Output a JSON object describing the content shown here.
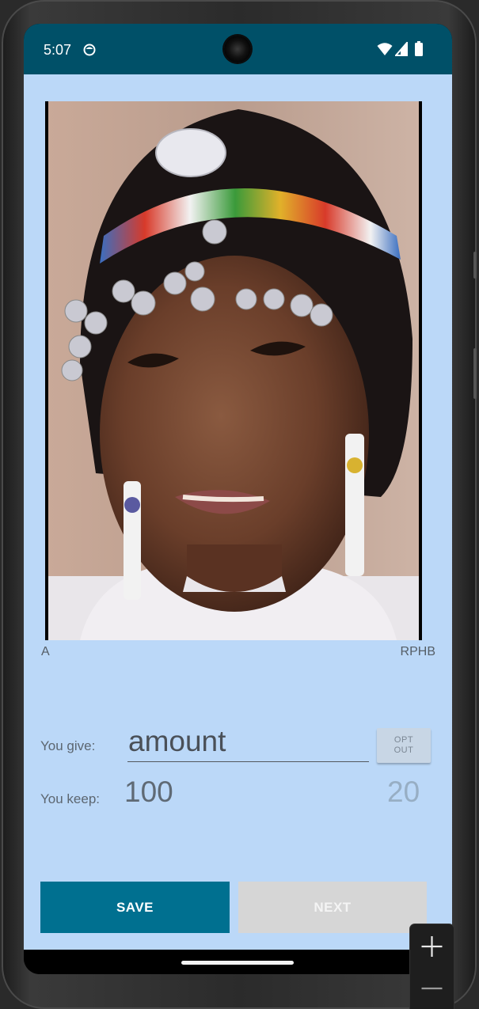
{
  "status_bar": {
    "time": "5:07",
    "app_icon": "circle-face-icon",
    "icons": [
      "wifi-icon",
      "signal-icon",
      "battery-icon"
    ],
    "background": "#005068"
  },
  "photo": {
    "description_icon": "portrait-photo",
    "left_label": "A",
    "right_label": "RPHB"
  },
  "form": {
    "give_label": "You give:",
    "amount_placeholder": "amount",
    "opt_out_label": "OPT\nOUT",
    "keep_label": "You keep:",
    "keep_value": "100",
    "other_value": "20"
  },
  "buttons": {
    "save_label": "SAVE",
    "next_label": "NEXT",
    "save_color": "#007090",
    "next_color": "#d6d6d6"
  },
  "zoom_controls": {
    "plus_icon": "plus-icon",
    "minus_icon": "minus-icon"
  },
  "colors": {
    "content_background": "#bbd8f8"
  }
}
